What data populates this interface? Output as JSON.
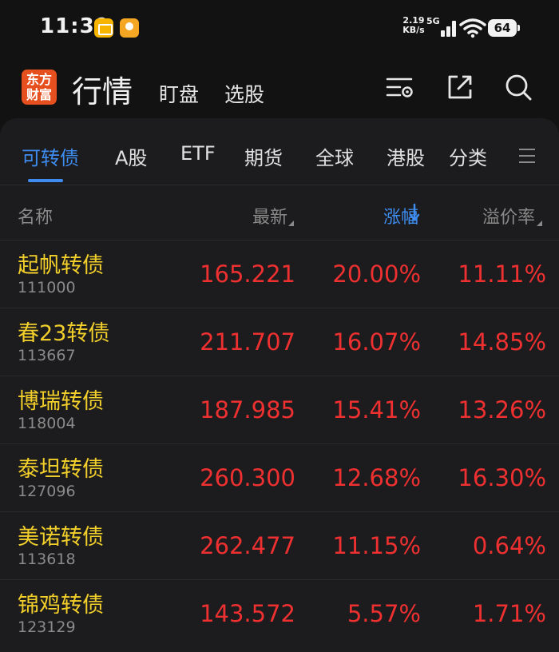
{
  "status_bar": {
    "time": "11:39",
    "net_speed_value": "2.19",
    "net_speed_unit": "KB/s",
    "network": "5G",
    "battery": "64"
  },
  "header": {
    "logo_line1": "东方",
    "logo_line2": "财富",
    "title": "行情",
    "link_watch": "盯盘",
    "link_screen": "选股",
    "icons": [
      "settings-icon",
      "share-icon",
      "search-icon"
    ]
  },
  "tabs": [
    "可转债",
    "A股",
    "ETF",
    "期货",
    "全球",
    "港股",
    "分类"
  ],
  "active_tab": "可转债",
  "columns": {
    "name": "名称",
    "price": "最新",
    "change": "涨幅",
    "premium": "溢价率"
  },
  "rows": [
    {
      "name": "起帆转债",
      "code": "111000",
      "price": "165.221",
      "change": "20.00%",
      "premium": "11.11%"
    },
    {
      "name": "春23转债",
      "code": "113667",
      "price": "211.707",
      "change": "16.07%",
      "premium": "14.85%"
    },
    {
      "name": "博瑞转债",
      "code": "118004",
      "price": "187.985",
      "change": "15.41%",
      "premium": "13.26%"
    },
    {
      "name": "泰坦转债",
      "code": "127096",
      "price": "260.300",
      "change": "12.68%",
      "premium": "16.30%"
    },
    {
      "name": "美诺转债",
      "code": "113618",
      "price": "262.477",
      "change": "11.15%",
      "premium": "0.64%"
    },
    {
      "name": "锦鸡转债",
      "code": "123129",
      "price": "143.572",
      "change": "5.57%",
      "premium": "1.71%"
    }
  ],
  "colors": {
    "background": "#121212",
    "card": "#1c1c1e",
    "accent_blue": "#3e8cf0",
    "up_red": "#ee3030",
    "name_yellow": "#f2cf2a",
    "logo_orange": "#e5501e"
  }
}
